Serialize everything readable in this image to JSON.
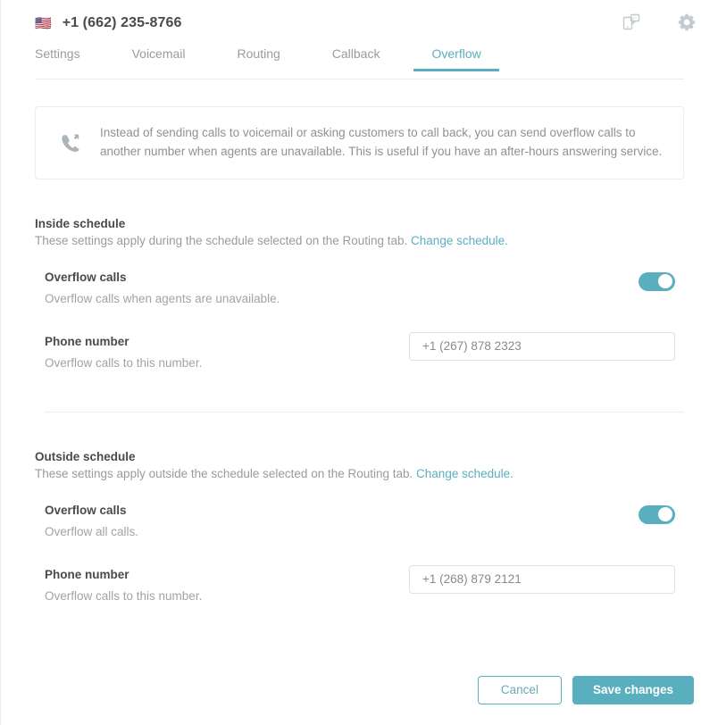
{
  "header": {
    "flag": "🇺🇸",
    "phone_number": "+1 (662) 235-8766",
    "device_icon": "device-transfer-icon",
    "settings_icon": "gear-icon"
  },
  "tabs": [
    {
      "label": "Settings",
      "active": false
    },
    {
      "label": "Voicemail",
      "active": false
    },
    {
      "label": "Routing",
      "active": false
    },
    {
      "label": "Callback",
      "active": false
    },
    {
      "label": "Overflow",
      "active": true
    }
  ],
  "notice": {
    "icon": "call-forward-icon",
    "text": "Instead of sending calls to voicemail or asking customers to call back, you can send overflow calls to another number when agents are unavailable. This is useful if you have an after-hours answering service."
  },
  "inside_schedule": {
    "title": "Inside schedule",
    "description": "These settings apply during the schedule selected on the Routing tab.",
    "link": "Change schedule.",
    "overflow": {
      "title": "Overflow calls",
      "description": "Overflow calls when agents are unavailable.",
      "enabled": true
    },
    "phone": {
      "title": "Phone number",
      "description": "Overflow calls to this number.",
      "value": "+1 (267) 878 2323",
      "placeholder": "+1 (267) 878 2323"
    }
  },
  "outside_schedule": {
    "title": "Outside schedule",
    "description": "These settings apply outside the schedule selected on the Routing tab.",
    "link": "Change schedule.",
    "overflow": {
      "title": "Overflow calls",
      "description": "Overflow all calls.",
      "enabled": true
    },
    "phone": {
      "title": "Phone number",
      "description": "Overflow calls to this number.",
      "value": "+1 (268) 879 2121",
      "placeholder": "+1 (268) 879 2121"
    }
  },
  "footer": {
    "cancel_label": "Cancel",
    "save_label": "Save changes"
  },
  "colors": {
    "accent": "#5aafbf",
    "link": "#5aafc0",
    "text": "#4a4a4a",
    "muted": "#9b9b9b",
    "border": "#ececec"
  }
}
